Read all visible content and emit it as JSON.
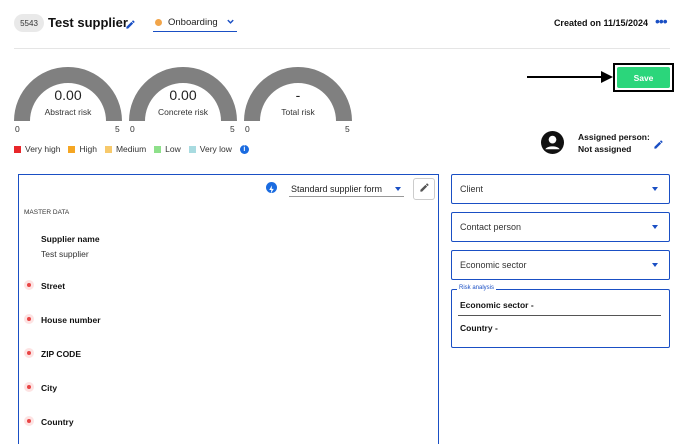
{
  "header": {
    "supplier_id": "5543",
    "supplier_title": "Test supplier",
    "status": "Onboarding",
    "created": "Created on 11/15/2024",
    "more_icon": "more-dots-icon"
  },
  "gauges": [
    {
      "value": "0.00",
      "label": "Abstract risk",
      "min": "0",
      "max": "5"
    },
    {
      "value": "0.00",
      "label": "Concrete risk",
      "min": "0",
      "max": "5"
    },
    {
      "value": "-",
      "label": "Total risk",
      "min": "0",
      "max": "5"
    }
  ],
  "legend": [
    {
      "label": "Very high",
      "color": "#e8262a"
    },
    {
      "label": "High",
      "color": "#f5a623"
    },
    {
      "label": "Medium",
      "color": "#f7c96b"
    },
    {
      "label": "Low",
      "color": "#8ee08a"
    },
    {
      "label": "Very low",
      "color": "#a8dbe0"
    }
  ],
  "save_label": "Save",
  "assigned": {
    "label": "Assigned person:",
    "value": "Not assigned"
  },
  "form": {
    "template": "Standard supplier form",
    "section": "MASTER DATA",
    "fields": [
      {
        "label": "Supplier name",
        "value": "Test supplier"
      },
      {
        "label": "Street"
      },
      {
        "label": "House number"
      },
      {
        "label": "ZIP CODE"
      },
      {
        "label": "City"
      },
      {
        "label": "Country"
      }
    ]
  },
  "side": {
    "client": "Client",
    "contact": "Contact person",
    "sector": "Economic sector",
    "risk_title": "Risk analysis",
    "risk_sector": "Economic sector -",
    "risk_country": "Country -"
  },
  "colors": {
    "accent": "#1a4fc4",
    "save": "#2bd67b",
    "gauge": "#808080"
  }
}
